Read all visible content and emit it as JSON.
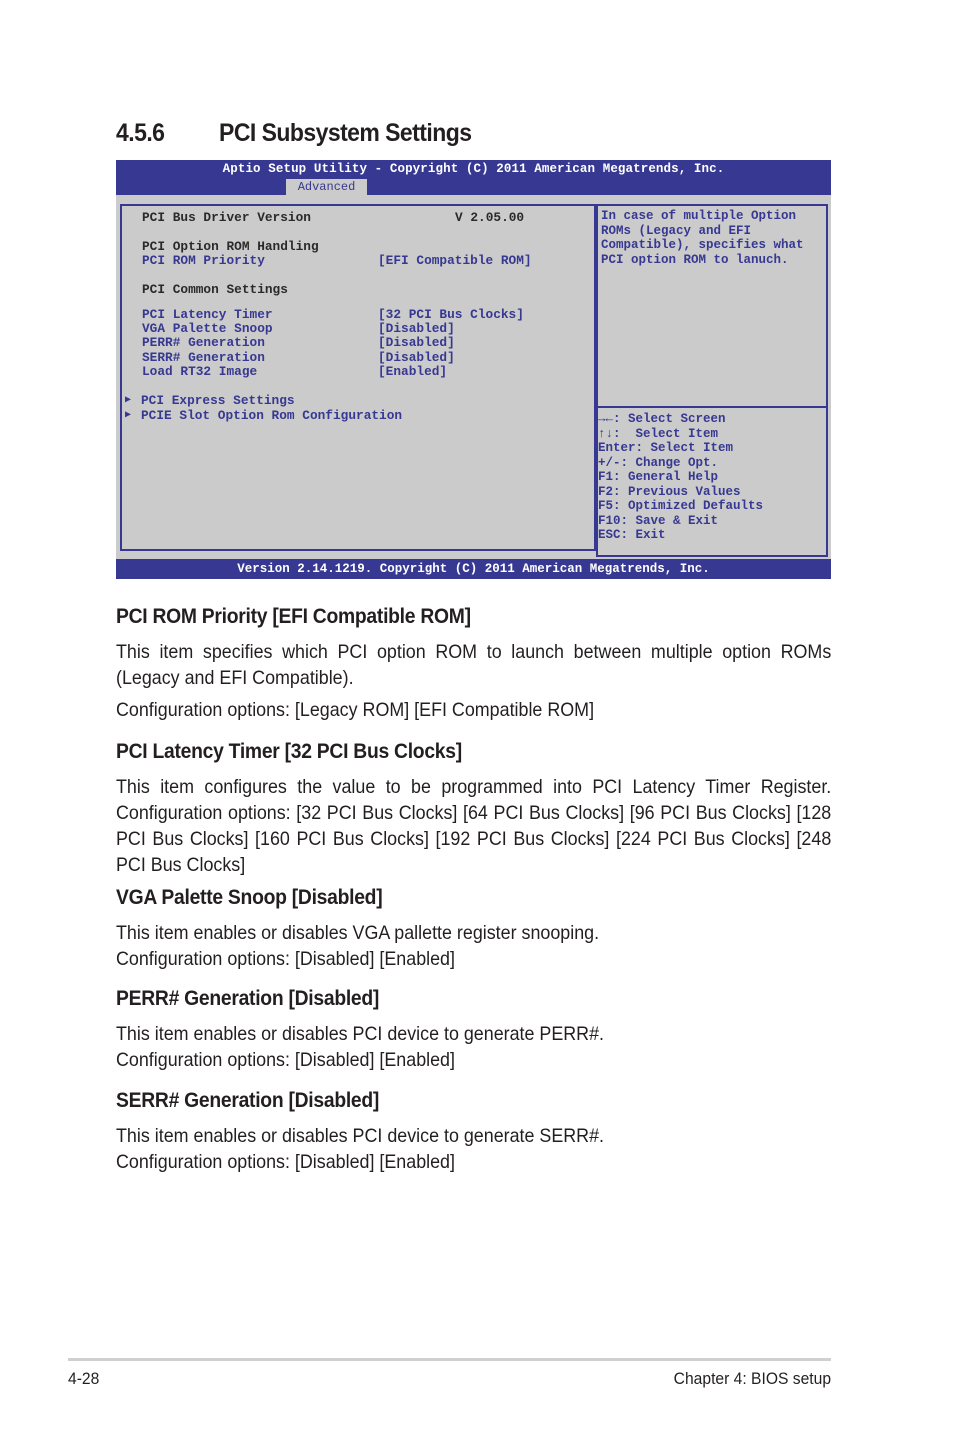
{
  "section": {
    "number": "4.5.6",
    "title": "PCI Subsystem Settings"
  },
  "bios": {
    "title": "Aptio Setup Utility - Copyright (C) 2011 American Megatrends, Inc.",
    "active_tab": "Advanced",
    "colors": {
      "header": "#373891",
      "panel": "#cbcbcb",
      "highlight_text": "#373891"
    },
    "rows": [
      {
        "label": "PCI Bus Driver Version",
        "value": "V 2.05.00",
        "selectable": false
      },
      {
        "label": "PCI Option ROM Handling",
        "value": "",
        "selectable": false
      },
      {
        "label": "PCI ROM Priority",
        "value": "[EFI Compatible ROM]",
        "selectable": true
      },
      {
        "label": "PCI Common Settings",
        "value": "",
        "selectable": false
      },
      {
        "label": "PCI Latency Timer",
        "value": "[32 PCI Bus Clocks]",
        "selectable": true
      },
      {
        "label": "VGA Palette Snoop",
        "value": "[Disabled]",
        "selectable": true
      },
      {
        "label": "PERR# Generation",
        "value": "[Disabled]",
        "selectable": true
      },
      {
        "label": "SERR# Generation",
        "value": "[Disabled]",
        "selectable": true
      },
      {
        "label": "Load RT32 Image",
        "value": "[Enabled]",
        "selectable": true
      }
    ],
    "submenus": [
      {
        "label": "PCI Express Settings",
        "icon": "submenu-arrow-icon"
      },
      {
        "label": "PCIE Slot Option Rom Configuration",
        "icon": "submenu-arrow-icon"
      }
    ],
    "help_text": "In case of multiple Option\nROMs (Legacy and EFI\nCompatible), specifies what\nPCI option ROM to lanuch.",
    "key_legend": [
      "→←: Select Screen",
      "↑↓:  Select Item",
      "Enter: Select Item",
      "+/-: Change Opt.",
      "F1: General Help",
      "F2: Previous Values",
      "F5: Optimized Defaults",
      "F10: Save & Exit",
      "ESC: Exit"
    ],
    "footer": "Version 2.14.1219. Copyright (C) 2011 American Megatrends, Inc."
  },
  "items": [
    {
      "heading": "PCI ROM Priority [EFI Compatible ROM]",
      "description": "This item specifies which PCI option ROM to launch between multiple option ROMs (Legacy and EFI Compatible).",
      "options": "Configuration options: [Legacy ROM] [EFI Compatible ROM]"
    },
    {
      "heading": "PCI Latency Timer [32 PCI Bus Clocks]",
      "description": "This item configures the value to be programmed into PCI Latency Timer Register. Configuration options: [32 PCI Bus Clocks] [64 PCI Bus Clocks] [96 PCI Bus Clocks] [128 PCI Bus Clocks] [160 PCI Bus Clocks] [192 PCI Bus Clocks] [224 PCI Bus Clocks] [248 PCI Bus Clocks]"
    },
    {
      "heading": "VGA Palette Snoop [Disabled]",
      "description": "This item enables or disables VGA pallette register snooping.",
      "options": "Configuration options: [Disabled] [Enabled]"
    },
    {
      "heading": "PERR# Generation [Disabled]",
      "description": "This item enables or disables PCI device to generate PERR#.",
      "options": "Configuration options: [Disabled] [Enabled]"
    },
    {
      "heading": "SERR# Generation [Disabled]",
      "description": "This item enables or disables PCI device to generate SERR#.",
      "options": "Configuration options: [Disabled] [Enabled]"
    }
  ],
  "page_footer": {
    "page_number": "4-28",
    "chapter": "Chapter 4: BIOS setup"
  }
}
